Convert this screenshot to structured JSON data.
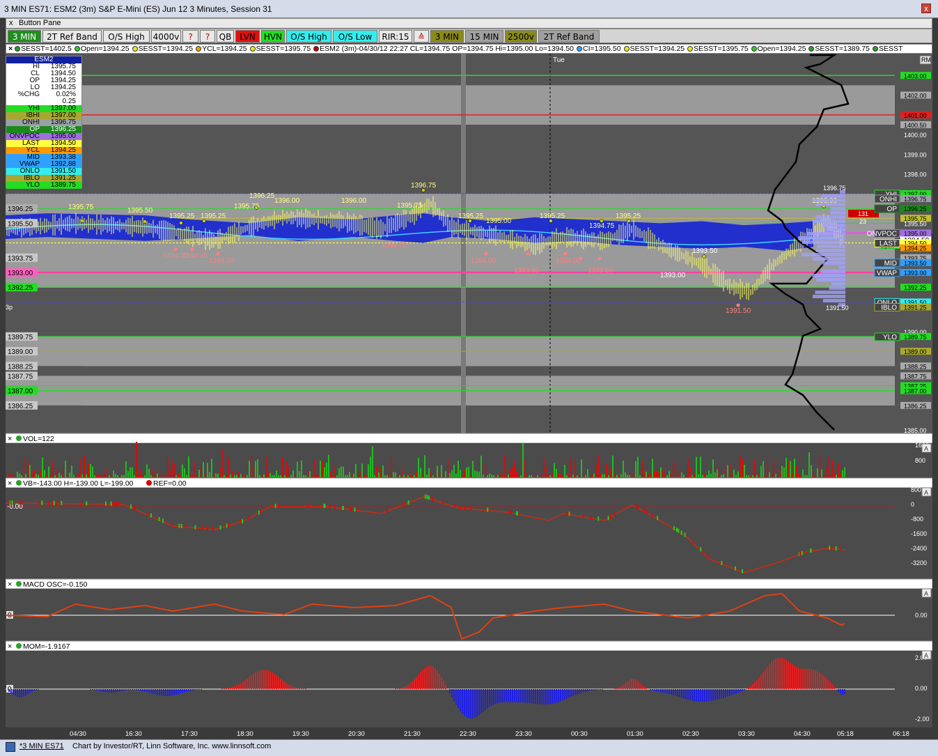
{
  "window": {
    "title": "3 MIN ES71: ESM2 (3m) S&P E-Mini (ES) Jun 12 3 Minutes, Session 31",
    "close": "x"
  },
  "button_pane": {
    "close": "x",
    "label": "Button Pane"
  },
  "toolbar": [
    {
      "label": "3 MIN",
      "bg": "#1f8f1f",
      "fg": "#ffffff"
    },
    {
      "label": "2T Ref Band",
      "bg": "#e8e8e8",
      "fg": "#000000"
    },
    {
      "label": "O/S High",
      "bg": "#e8e8e8",
      "fg": "#000000"
    },
    {
      "label": "4000v",
      "bg": "#e8e8e8",
      "fg": "#000000"
    },
    {
      "label": "?",
      "bg": "#e8e8e8",
      "fg": "#c00000"
    },
    {
      "label": "?",
      "bg": "#e8e8e8",
      "fg": "#c00000"
    },
    {
      "label": "QB",
      "bg": "#e8e8e8",
      "fg": "#000000"
    },
    {
      "label": "LVN",
      "bg": "#e01010",
      "fg": "#000000"
    },
    {
      "label": "HVN",
      "bg": "#22dd22",
      "fg": "#000000"
    },
    {
      "label": "O/S High",
      "bg": "#33eeee",
      "fg": "#000000"
    },
    {
      "label": "O/S Low",
      "bg": "#33eeee",
      "fg": "#000000"
    },
    {
      "label": "RIR:15",
      "bg": "#e8e8e8",
      "fg": "#000000"
    },
    {
      "label": "≙",
      "bg": "#e8e8e8",
      "fg": "#c00000"
    },
    {
      "label": "3 MIN",
      "bg": "#8a8a1a",
      "fg": "#000000"
    },
    {
      "label": "15 MIN",
      "bg": "#a0a0a0",
      "fg": "#000000"
    },
    {
      "label": "2500v",
      "bg": "#8a8a1a",
      "fg": "#000000"
    },
    {
      "label": "2T Ref Band",
      "bg": "#a0a0a0",
      "fg": "#000000"
    }
  ],
  "status_items": [
    {
      "text": "SESST=1402.5",
      "color": "#2aa02a"
    },
    {
      "text": "Open=1394.25",
      "color": "#2ad02a"
    },
    {
      "text": "SESST=1394.25",
      "color": "#e8e820"
    },
    {
      "text": "YCL=1394.25",
      "color": "#f0a000"
    },
    {
      "text": "SESST=1395.75",
      "color": "#e8e820"
    },
    {
      "text": "ESM2 (3m)-04/30/12 22:27 CL=1394.75 OP=1394.75 Hi=1395.00 Lo=1394.50",
      "color": "#c00000"
    },
    {
      "text": "CI=1395.50",
      "color": "#30a0ff"
    },
    {
      "text": "SESST=1394.25",
      "color": "#e8e820"
    },
    {
      "text": "SESST=1395.75",
      "color": "#e8e820"
    },
    {
      "text": "Open=1394.25",
      "color": "#2ad02a"
    },
    {
      "text": "SESST=1389.75",
      "color": "#2aa02a"
    },
    {
      "text": "SESST",
      "color": "#2aa02a"
    }
  ],
  "legend": {
    "symbol": "ESM2",
    "rows": [
      {
        "label": "HI",
        "value": "1395.75",
        "bg": "#ffffff",
        "fg": "#000000"
      },
      {
        "label": "CL",
        "value": "1394.50",
        "bg": "#ffffff",
        "fg": "#000000"
      },
      {
        "label": "OP",
        "value": "1394.25",
        "bg": "#ffffff",
        "fg": "#000000"
      },
      {
        "label": "LO",
        "value": "1394.25",
        "bg": "#ffffff",
        "fg": "#000000"
      },
      {
        "label": "%CHG",
        "value": "0.02%",
        "bg": "#ffffff",
        "fg": "#000000"
      },
      {
        "label": "",
        "value": "0.25",
        "bg": "#ffffff",
        "fg": "#000000"
      },
      {
        "label": "YHI",
        "value": "1397.00",
        "bg": "#22dd22",
        "fg": "#000000"
      },
      {
        "label": "IBHI",
        "value": "1397.00",
        "bg": "#a8a830",
        "fg": "#000000"
      },
      {
        "label": "ONHI",
        "value": "1396.75",
        "bg": "#9aa0a8",
        "fg": "#000000"
      },
      {
        "label": "OP",
        "value": "1396.25",
        "bg": "#1a8a1a",
        "fg": "#ffffff"
      },
      {
        "label": "ONVPOC",
        "value": "1395.00",
        "bg": "#a070e0",
        "fg": "#000000"
      },
      {
        "label": "LAST",
        "value": "1394.50",
        "bg": "#ffff40",
        "fg": "#000000"
      },
      {
        "label": "YCL",
        "value": "1394.25",
        "bg": "#ff9900",
        "fg": "#000000"
      },
      {
        "label": "MID",
        "value": "1393.38",
        "bg": "#30a0ff",
        "fg": "#000000"
      },
      {
        "label": "VWAP",
        "value": "1392.88",
        "bg": "#30a0ff",
        "fg": "#000000"
      },
      {
        "label": "ONLO",
        "value": "1391.50",
        "bg": "#30eeee",
        "fg": "#000000"
      },
      {
        "label": "IBLO",
        "value": "1391.25",
        "bg": "#a8a830",
        "fg": "#000000"
      },
      {
        "label": "YLO",
        "value": "1389.75",
        "bg": "#22dd22",
        "fg": "#000000"
      }
    ]
  },
  "price_axis": {
    "labels": [
      "1403.00",
      "1402.00",
      "1401.00",
      "1400.50",
      "1400.00",
      "1399.00",
      "1398.00",
      "1397.00",
      "1396.75",
      "1396.25",
      "1395.75",
      "1395.50",
      "1395.00",
      "1394.50",
      "1394.25",
      "1393.75",
      "1393.50",
      "1393.00",
      "1392.25",
      "1391.50",
      "1391.25",
      "1390.00",
      "1389.75",
      "1389.00",
      "1388.25",
      "1387.75",
      "1387.25",
      "1387.00",
      "1386.25",
      "1385.00"
    ]
  },
  "right_tags": [
    {
      "text": "YHI",
      "price": 1397.0,
      "bg": "#22dd22"
    },
    {
      "text": "ONHI",
      "price": 1396.75,
      "bg": "#9aa0a8"
    },
    {
      "text": "OP",
      "price": 1396.25,
      "bg": "#1a8a1a"
    },
    {
      "text": "ONVPOC",
      "price": 1395.0,
      "bg": "#a070e0"
    },
    {
      "text": "LAST",
      "price": 1394.5,
      "bg": "#ffff40"
    },
    {
      "text": "MID",
      "price": 1393.5,
      "bg": "#30a0ff"
    },
    {
      "text": "VWAP",
      "price": 1393.0,
      "bg": "#30a0ff"
    },
    {
      "text": "ONLO",
      "price": 1391.5,
      "bg": "#30eeee"
    },
    {
      "text": "IBLO",
      "price": 1391.25,
      "bg": "#a8a830"
    },
    {
      "text": "YLO",
      "price": 1389.75,
      "bg": "#22dd22"
    }
  ],
  "left_tags": [
    "1396.25",
    "1395.50",
    "1393.75",
    "1393.00",
    "1392.25",
    "1389.75",
    "1389.00",
    "1388.25",
    "1387.75",
    "1387.00",
    "1386.25"
  ],
  "left_corner": "3p",
  "chart_labels": {
    "tue": "Tue",
    "hi": "1396.75",
    "lo": "1391.50",
    "last": "1394.50",
    "box131": "131",
    "box23": "23",
    "open": "Open",
    "rm": "RM",
    "callouts": [
      "1395.75",
      "1395.50",
      "1395.25",
      "1395.25",
      "1395.75",
      "1396.25",
      "1396.00",
      "1396.00",
      "1395.75",
      "1396.75",
      "1395.25",
      "1395.00",
      "1395.25",
      "1394.75",
      "1395.25",
      "1396.00",
      "1393.50",
      "1393.00",
      "1394.75",
      "1394.25",
      "1394.25",
      "1394.00",
      "1394.00",
      "1393.50",
      "1394.00",
      "1393.50",
      "1391.50"
    ]
  },
  "panes": {
    "vol": {
      "label": "VOL=122",
      "axis": [
        "1600",
        "800"
      ]
    },
    "vb": {
      "label": "VB=-143.00 H=-139.00 L=-199.00",
      "ref": "REF=0.00",
      "axis": [
        "800",
        "0",
        "-800",
        "-1600",
        "-2400",
        "-3200"
      ],
      "left": "-0.00"
    },
    "macd": {
      "label": "MACD OSC=-0.150",
      "axis": [
        "0.00"
      ],
      "left": "0"
    },
    "mom": {
      "label": "MOM=-1.9167",
      "axis": [
        "2.00",
        "0.00",
        "-2.00"
      ],
      "left": "0"
    }
  },
  "time_axis": [
    "04/30",
    "16:30",
    "17:30",
    "18:30",
    "19:30",
    "20:30",
    "21:30",
    "22:30",
    "23:30",
    "00:30",
    "01:30",
    "02:30",
    "03:30",
    "04:30",
    "05:18",
    "06:18"
  ],
  "bottom": {
    "tab": "*3 MIN ES71",
    "credit": "Chart by Investor/RT, Linn Software, Inc. www.linnsoft.com"
  }
}
